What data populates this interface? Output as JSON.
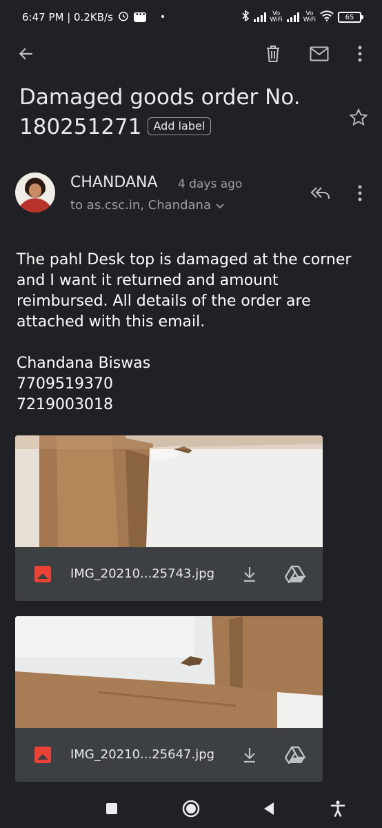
{
  "status_bar": {
    "time_speed": "6:47 PM | 0.2KB/s",
    "dot": "•",
    "vo_wifi_1": "Vo\nWiFi",
    "vo_wifi_2": "Vo\nWiFi",
    "battery": "65"
  },
  "toolbar": {
    "back_icon": "arrow-back",
    "delete_icon": "trash",
    "mark_icon": "mail",
    "more_icon": "more-vert"
  },
  "email": {
    "subject": "Damaged goods order No. 180251271",
    "add_label": "Add label",
    "starred": false,
    "sender_name": "CHANDANA",
    "sent_time": "4 days ago",
    "recipients": "to as.csc.in, Chandana",
    "body": "The pahl Desk top is damaged at the corner and I want it returned and amount reimbursed. All details of the order are attached with this email.\n\nChandana Biswas\n7709519370\n7219003018"
  },
  "attachments": [
    {
      "file_name": "IMG_20210...25743.jpg"
    },
    {
      "file_name": "IMG_20210...25647.jpg"
    }
  ],
  "colors": {
    "background": "#202124",
    "attachment_bar": "#3c4043",
    "image_icon": "#ea4335",
    "text_primary": "#e8eaed",
    "text_secondary": "#9aa0a6"
  }
}
